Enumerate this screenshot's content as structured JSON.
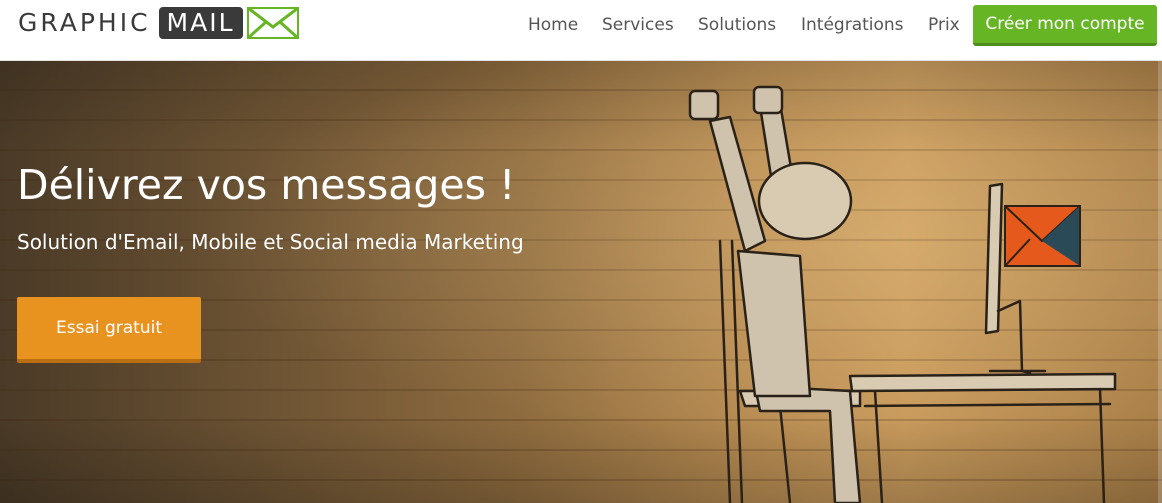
{
  "header": {
    "logo": {
      "word1": "GRAPHIC",
      "word2": "MAIL",
      "icon": "envelope-icon"
    },
    "nav": [
      {
        "label": "Home"
      },
      {
        "label": "Services"
      },
      {
        "label": "Solutions"
      },
      {
        "label": "Intégrations"
      },
      {
        "label": "Prix"
      }
    ],
    "cta_label": "Créer mon compte"
  },
  "hero": {
    "title": "Délivrez vos messages !",
    "subtitle": "Solution d'Email, Mobile et Social media Marketing",
    "cta_label": "Essai gratuit",
    "illustration": "stick-figure-celebrating-at-computer"
  },
  "colors": {
    "brand_green": "#66b524",
    "cta_orange": "#e8921f",
    "logo_dark": "#3a3a3a",
    "envelope_orange": "#e55a1c",
    "envelope_teal": "#2b4a57"
  }
}
